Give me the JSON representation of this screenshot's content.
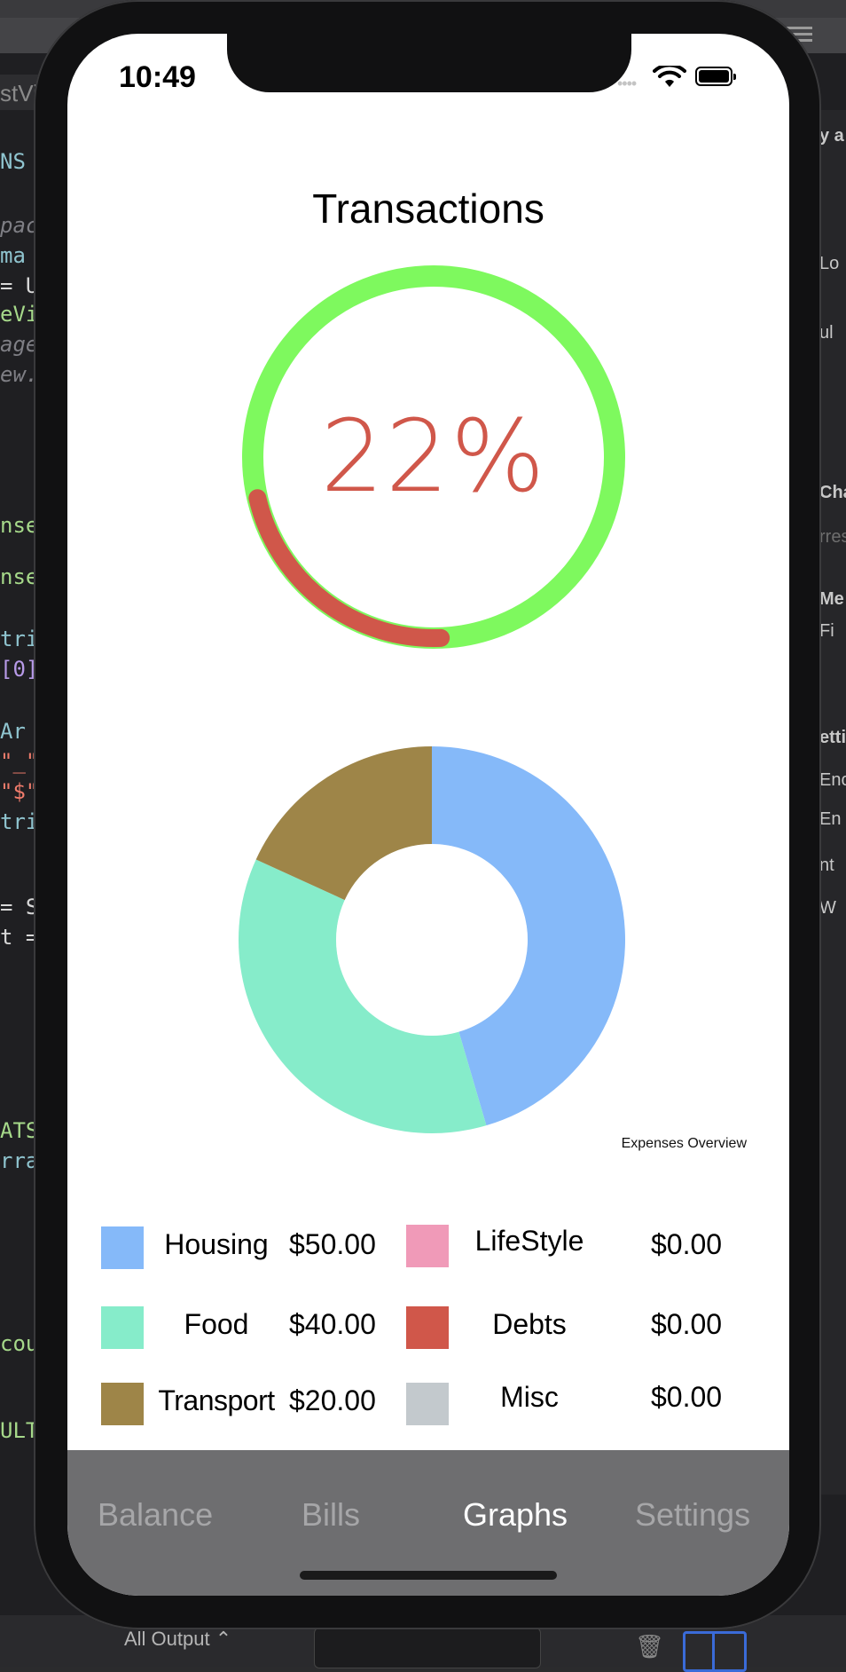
{
  "ide": {
    "tab_label": "stVi",
    "code_lines": [
      "NS",
      "pac",
      "ma",
      "= U",
      "eVi",
      "age",
      "ew.",
      "nse",
      "nse",
      "tri",
      "[0]",
      "Ar",
      "\"_\"",
      "\"$\"",
      "tri",
      "= S",
      "t =",
      "ATS",
      "rray",
      "cou",
      "ULT"
    ],
    "right_labels": [
      "y a",
      "Lo",
      "ul",
      "Cha",
      "rres",
      "Me",
      "Fi",
      "etti",
      "Enc",
      "En",
      "nt",
      "W"
    ],
    "bottom_output_label": "All Output ⌃"
  },
  "status_bar": {
    "time": "10:49",
    "signal_dots": "••••"
  },
  "screen": {
    "title": "Transactions",
    "progress_percent_label": "22%",
    "progress_fraction": 0.22,
    "caption": "Expenses Overview"
  },
  "colors": {
    "ring_track": "#7ef95e",
    "ring_progress": "#d0574a",
    "percent_text": "#d0574a",
    "housing": "#85b9f9",
    "food": "#86ecca",
    "transport": "#9e8548",
    "lifestyle": "#f09ab8",
    "debts": "#d0574a",
    "misc": "#c3c9cd",
    "tabbar_bg": "#6e6e70"
  },
  "chart_data": {
    "type": "pie",
    "title": "Expenses Overview",
    "categories": [
      "Housing",
      "Food",
      "Transport",
      "LifeStyle",
      "Debts",
      "Misc"
    ],
    "values": [
      50,
      40,
      20,
      0,
      0,
      0
    ],
    "donut": true
  },
  "legend": {
    "left": [
      {
        "label": "Housing",
        "value": "$50.00"
      },
      {
        "label": "Food",
        "value": "$40.00"
      },
      {
        "label": "Transport",
        "value": "$20.00"
      }
    ],
    "right": [
      {
        "label": "LifeStyle",
        "value": "$0.00"
      },
      {
        "label": "Debts",
        "value": "$0.00"
      },
      {
        "label": "Misc",
        "value": "$0.00"
      }
    ]
  },
  "tabs": [
    {
      "label": "Balance",
      "active": false
    },
    {
      "label": "Bills",
      "active": false
    },
    {
      "label": "Graphs",
      "active": true
    },
    {
      "label": "Settings",
      "active": false
    }
  ]
}
